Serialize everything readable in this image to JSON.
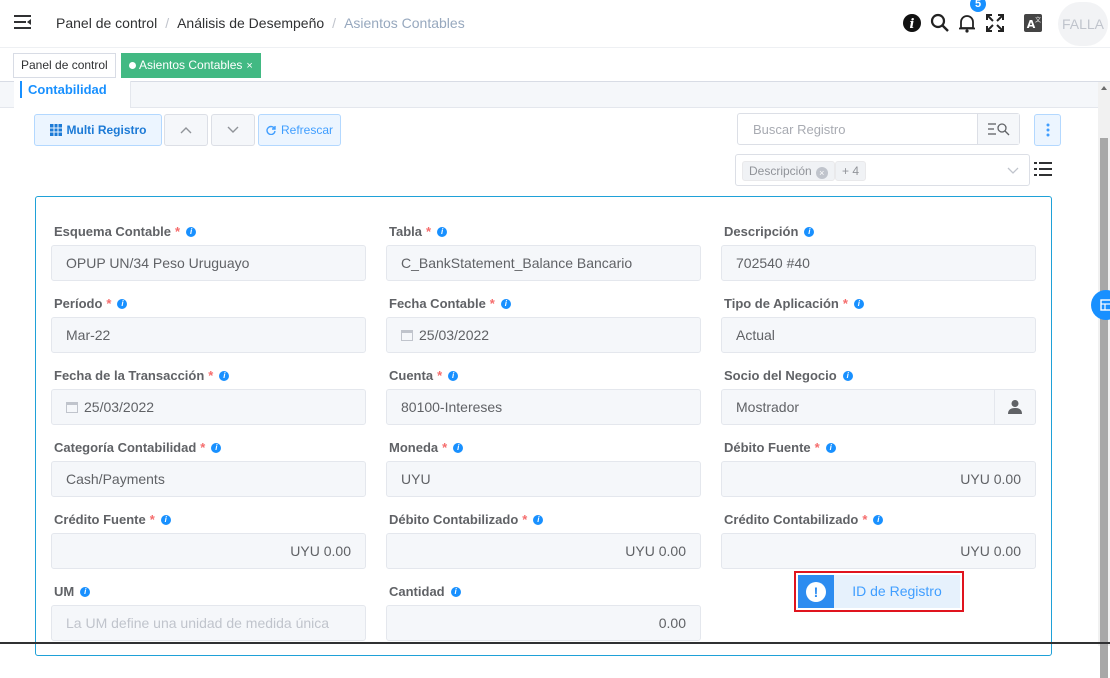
{
  "breadcrumb": [
    "Panel de control",
    "Análisis de Desempeño",
    "Asientos Contables"
  ],
  "notifications_count": "5",
  "user_initials": "FALLA",
  "tags": [
    {
      "label": "Panel de control",
      "active": false
    },
    {
      "label": "Asientos Contables",
      "active": true,
      "close": "×"
    }
  ],
  "tab_label": "Contabilidad",
  "toolbar": {
    "multi_registro": "Multi Registro",
    "refrescar": "Refrescar",
    "search_placeholder": "Buscar Registro",
    "column_chip": "Descripción",
    "more_chip": "+ 4"
  },
  "fields": [
    {
      "label": "Esquema Contable",
      "required": true,
      "value": "OPUP UN/34 Peso Uruguayo"
    },
    {
      "label": "Tabla",
      "required": true,
      "value": "C_BankStatement_Balance Bancario"
    },
    {
      "label": "Descripción",
      "required": false,
      "value": "702540 #40"
    },
    {
      "label": "Período",
      "required": true,
      "value": "Mar-22"
    },
    {
      "label": "Fecha Contable",
      "required": true,
      "value": "25/03/2022"
    },
    {
      "label": "Tipo de Aplicación",
      "required": true,
      "value": "Actual"
    },
    {
      "label": "Fecha de la Transacción",
      "required": true,
      "value": "25/03/2022"
    },
    {
      "label": "Cuenta",
      "required": true,
      "value": "80100-Intereses"
    },
    {
      "label": "Socio del Negocio",
      "required": false,
      "value": "Mostrador"
    },
    {
      "label": "Categoría Contabilidad",
      "required": true,
      "value": "Cash/Payments"
    },
    {
      "label": "Moneda",
      "required": true,
      "value": "UYU"
    },
    {
      "label": "Débito Fuente",
      "required": true,
      "value": "UYU 0.00"
    },
    {
      "label": "Crédito Fuente",
      "required": true,
      "value": "UYU 0.00"
    },
    {
      "label": "Débito Contabilizado",
      "required": true,
      "value": "UYU 0.00"
    },
    {
      "label": "Crédito Contabilizado",
      "required": true,
      "value": "UYU 0.00"
    },
    {
      "label": "UM",
      "required": false,
      "placeholder": "La UM define una unidad de medida única"
    },
    {
      "label": "Cantidad",
      "required": false,
      "value": "0.00"
    }
  ],
  "required_mark": "*",
  "info_glyph": "i",
  "record_id_label": "ID de Registro",
  "record_id_icon": "!",
  "colors": {
    "accent": "#1890ff",
    "tag_active": "#42b983",
    "highlight_border": "#e0141e",
    "required": "#f56c6c"
  }
}
